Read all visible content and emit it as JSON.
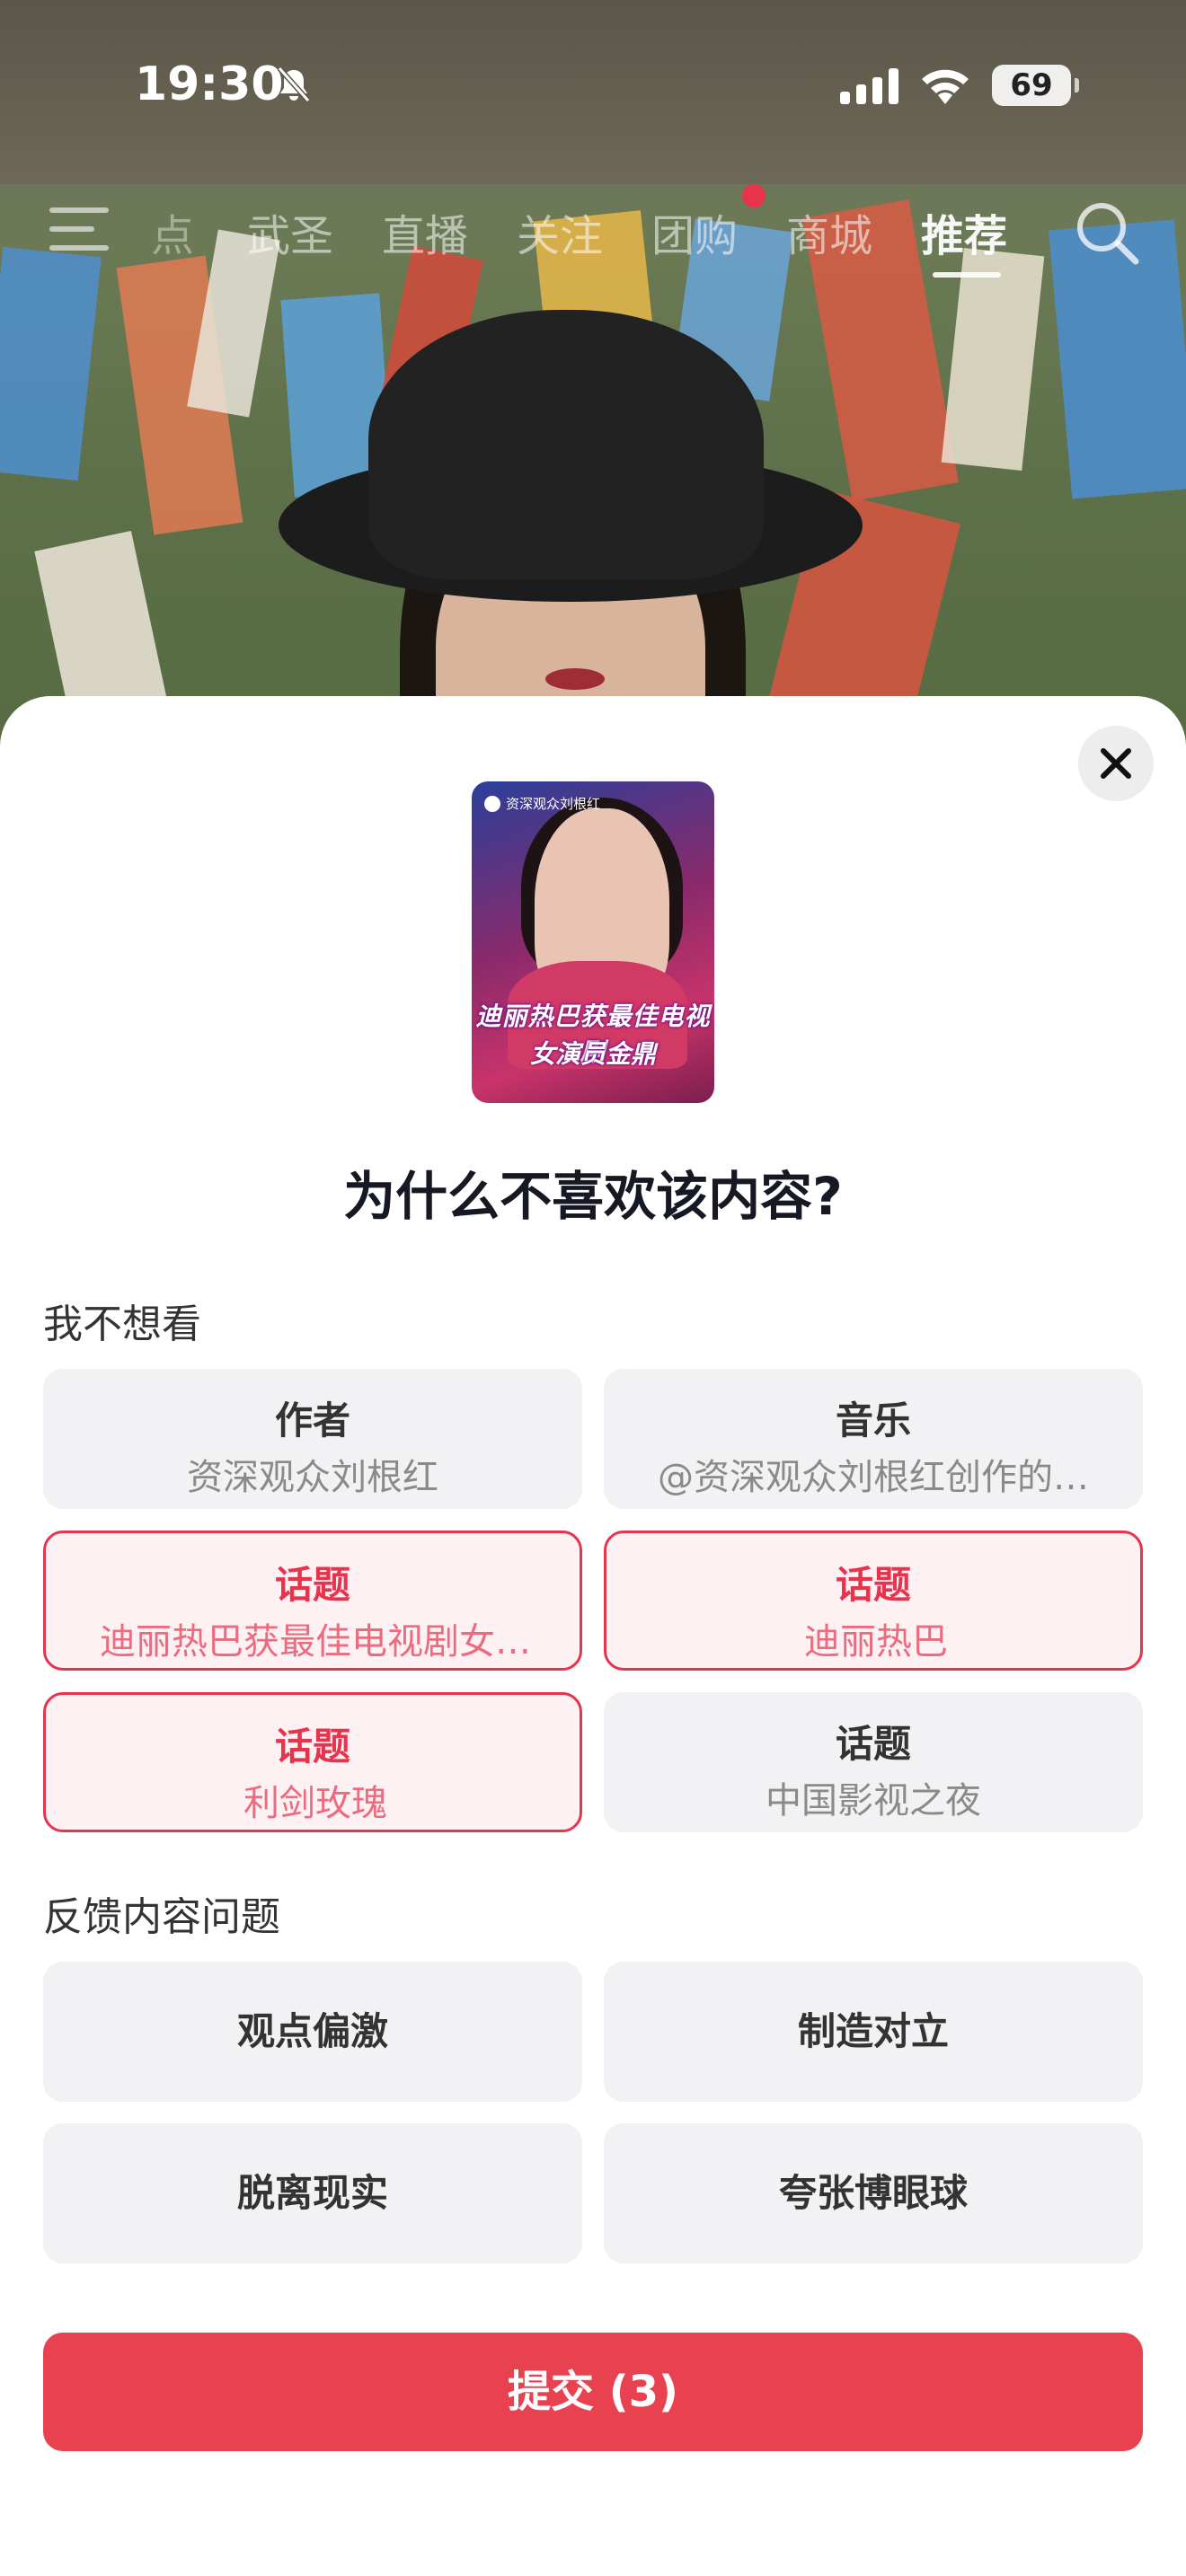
{
  "status_bar": {
    "time": "19:30",
    "battery": "69"
  },
  "top_nav": {
    "tabs": [
      "点",
      "武圣",
      "直播",
      "关注",
      "团购",
      "商城",
      "推荐"
    ],
    "active_tab": "推荐"
  },
  "sheet": {
    "thumbnail": {
      "author": "资深观众刘根红",
      "caption_line1": "迪丽热巴获最佳电视剧",
      "caption_line2": "女演员金鼎"
    },
    "title": "为什么不喜欢该内容?",
    "section1": {
      "label": "我不想看",
      "options": [
        {
          "title": "作者",
          "subtitle": "资深观众刘根红",
          "selected": false
        },
        {
          "title": "音乐",
          "subtitle": "@资深观众刘根红创作的…",
          "selected": false
        },
        {
          "title": "话题",
          "subtitle": "迪丽热巴获最佳电视剧女…",
          "selected": true
        },
        {
          "title": "话题",
          "subtitle": "迪丽热巴",
          "selected": true
        },
        {
          "title": "话题",
          "subtitle": "利剑玫瑰",
          "selected": true
        },
        {
          "title": "话题",
          "subtitle": "中国影视之夜",
          "selected": false
        }
      ]
    },
    "section2": {
      "label": "反馈内容问题",
      "options": [
        "观点偏激",
        "制造对立",
        "脱离现实",
        "夸张博眼球"
      ]
    },
    "submit_label": "提交 (3)"
  },
  "colors": {
    "accent": "#e8334d",
    "submit": "#e8414f",
    "option_bg": "#f2f2f4",
    "selected_bg": "#fdf1f3"
  }
}
